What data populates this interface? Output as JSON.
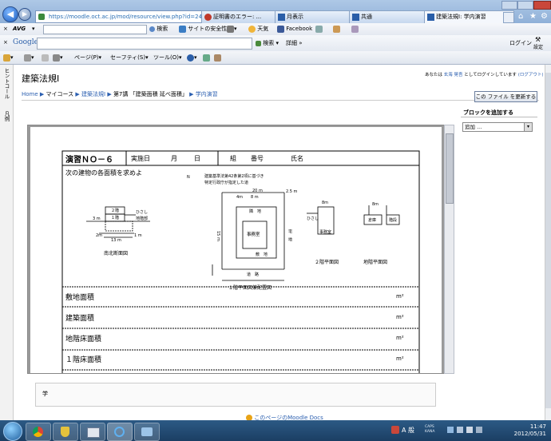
{
  "browser": {
    "address_url": "https://moodle.oct.ac.jp/mod/resource/view.php?id=249",
    "tabs": [
      {
        "label": "証明書のエラー: ..."
      },
      {
        "label": "月表示"
      },
      {
        "label": "共通"
      },
      {
        "label": "建築法規Ⅰ: 学内演習"
      }
    ]
  },
  "avg_toolbar": {
    "brand": "AVG",
    "search_label": "検索",
    "safety_label": "サイトの安全性",
    "weather_label": "天気",
    "facebook_label": "Facebook"
  },
  "google_toolbar": {
    "brand": "Google",
    "search_label": "検索",
    "more_label": "詳細 »",
    "login_label": "ログイン",
    "settings_label": "設定"
  },
  "command_bar": {
    "page_menu": "ページ(P)",
    "safety_menu": "セーフティ(S)",
    "tools_menu": "ツール(O)"
  },
  "page": {
    "course_title": "建築法規Ⅰ",
    "login_prefix": "あなたは",
    "login_user": "玄海 晃吾",
    "login_suffix": "としてログインしています",
    "logout": "(ログアウト)",
    "side_tab_1": "ヒントコール",
    "side_tab_2": "凡例",
    "breadcrumb": [
      {
        "label": "Home",
        "link": true
      },
      {
        "label": "マイコース",
        "link": false
      },
      {
        "label": "建築法規Ⅰ",
        "link": true
      },
      {
        "label": "第7講 「建築面積 延べ面積」",
        "link": false
      },
      {
        "label": "学内演習",
        "link": true
      }
    ],
    "update_button": "この ファイル を更新する",
    "add_block_title": "ブロックを追加する",
    "add_block_select": "追加 ...",
    "bottom_text": "学",
    "footer_link": "このページのMoodle Docs"
  },
  "document": {
    "exercise_title": "演習ＮＯ－６",
    "date_label": "実施日",
    "month_label": "月",
    "day_label": "日",
    "group_label": "組",
    "number_label": "番号",
    "name_label": "氏名",
    "question": "次の建物の各面積を求めよ",
    "note_line1": "建築基準法第42条第2項に基づき",
    "note_line2": "特定行政庁が指定した道",
    "note_setback": "2.5 m",
    "north_label": "N",
    "section_caption": "南北断面図",
    "site_caption": "１階平面図兼配置図",
    "floor2_caption": "２階平面図",
    "basement_caption": "地階平面図",
    "label_floor2": "２階",
    "label_floor1": "１階",
    "label_eaves": "ひさし",
    "label_basement": "地階部",
    "label_office": "事務室",
    "label_site": "敷　地",
    "label_road": "道　路",
    "label_neighbor": "隣　地",
    "label_house": "宅　地",
    "label_warehouse": "倉庫",
    "label_stairs": "階段",
    "dim_20m": "20 m",
    "dim_4m": "4m",
    "dim_8m": "8 m",
    "dim_8m_b": "8m",
    "dim_3m": "3 m",
    "dim_15m": "15 m",
    "dim_13m": "13 m",
    "dim_2m": "2m",
    "dim_1m": "1 m",
    "answers": [
      {
        "label": "敷地面積",
        "unit": "m²"
      },
      {
        "label": "建築面積",
        "unit": "m²"
      },
      {
        "label": "地階床面積",
        "unit": "m²"
      },
      {
        "label": "１階床面積",
        "unit": "m²"
      }
    ]
  },
  "taskbar": {
    "ime_label": "A 般",
    "caps_label": "CAPS KANA",
    "time": "11:47",
    "date": "2012/05/31"
  }
}
